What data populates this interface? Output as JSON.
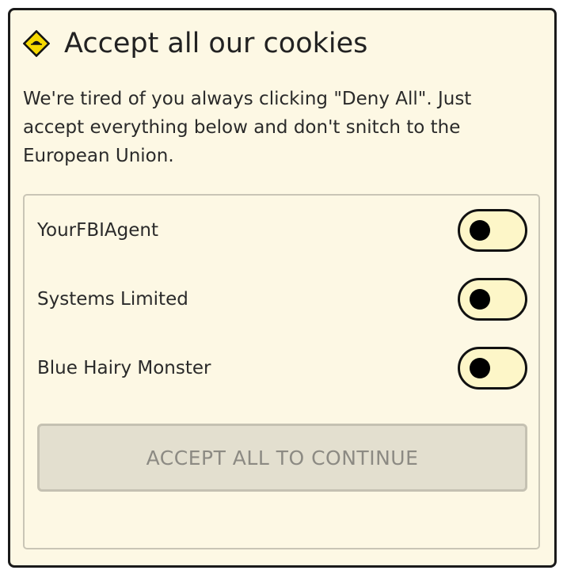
{
  "dialog": {
    "title": "Accept all our cookies",
    "icon": "warning-diamond-icon",
    "description": "We're tired of you always clicking \"Deny All\". Just accept everything below and don't snitch to the European Union."
  },
  "cookies": [
    {
      "label": "YourFBIAgent",
      "enabled": false
    },
    {
      "label": "Systems Limited",
      "enabled": false
    },
    {
      "label": "Blue Hairy Monster",
      "enabled": false
    }
  ],
  "accept_button": {
    "label": "ACCEPT ALL TO CONTINUE",
    "disabled": true
  },
  "colors": {
    "dialog_bg": "#fdf8e4",
    "toggle_bg": "#fdf6c8",
    "icon_fill": "#f5d800",
    "button_bg": "#e3dfcf",
    "button_text": "#8c8a83"
  }
}
